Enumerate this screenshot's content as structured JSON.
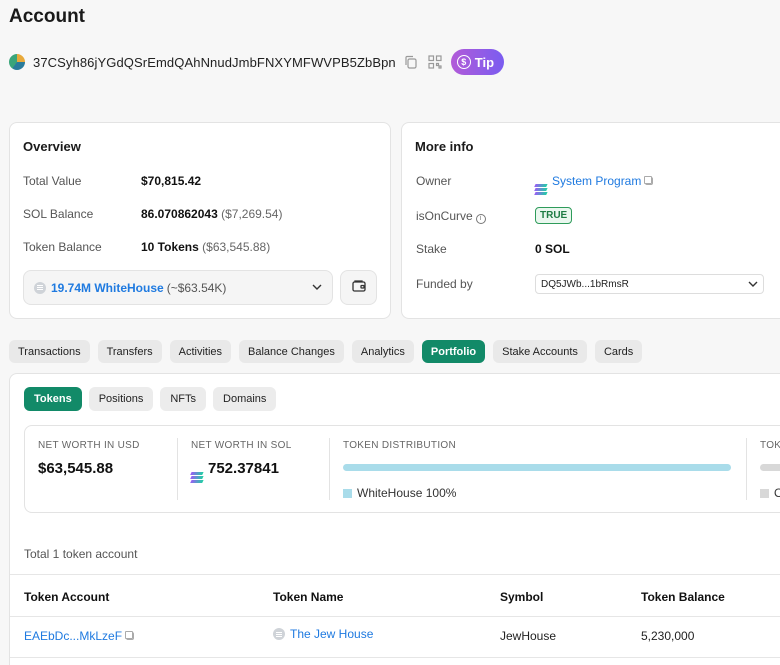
{
  "page": {
    "title": "Account"
  },
  "account": {
    "address": "37CSyh86jYGdQSrEmdQAhNnudJmbFNXYMFWVPB5ZbBpn",
    "tip_label": "Tip"
  },
  "overview": {
    "title": "Overview",
    "rows": [
      {
        "label": "Total Value",
        "value": "$70,815.42",
        "sub": ""
      },
      {
        "label": "SOL Balance",
        "value": "86.070862043",
        "sub": "($7,269.54)"
      },
      {
        "label": "Token Balance",
        "value": "10 Tokens",
        "sub": "($63,545.88)"
      }
    ],
    "token_select": {
      "value": "19.74M WhiteHouse",
      "sub": "(~$63.54K)"
    }
  },
  "more_info": {
    "title": "More info",
    "owner_label": "Owner",
    "owner_value": "System Program",
    "oncurve_label": "isOnCurve",
    "oncurve_value": "TRUE",
    "stake_label": "Stake",
    "stake_value": "0 SOL",
    "funded_label": "Funded by",
    "funded_value": "DQ5JWb...1bRmsR"
  },
  "tabs": [
    "Transactions",
    "Transfers",
    "Activities",
    "Balance Changes",
    "Analytics",
    "Portfolio",
    "Stake Accounts",
    "Cards"
  ],
  "active_tab": "Portfolio",
  "subtabs": [
    "Tokens",
    "Positions",
    "NFTs",
    "Domains"
  ],
  "active_subtab": "Tokens",
  "stats": {
    "net_worth_usd_label": "NET WORTH IN USD",
    "net_worth_usd": "$63,545.88",
    "net_worth_sol_label": "NET WORTH IN SOL",
    "net_worth_sol": "752.37841",
    "distribution_label": "TOKEN DISTRIBUTION",
    "distribution_name": "WhiteHouse",
    "distribution_pct": "100%",
    "distribution_fraction": 1.0,
    "cut_label": "TOKE",
    "cut_legend": "O"
  },
  "table": {
    "total_text": "Total 1 token account",
    "headers": [
      "Token Account",
      "Token Name",
      "Symbol",
      "Token Balance"
    ],
    "rows": [
      {
        "account": "EAEbDc...MkLzeF",
        "name": "The Jew House",
        "symbol": "JewHouse",
        "balance": "5,230,000"
      }
    ]
  },
  "colors": {
    "accent": "#128a68",
    "link": "#1f7ae0",
    "tip_from": "#b25bd8",
    "tip_to": "#7a5cf0"
  }
}
